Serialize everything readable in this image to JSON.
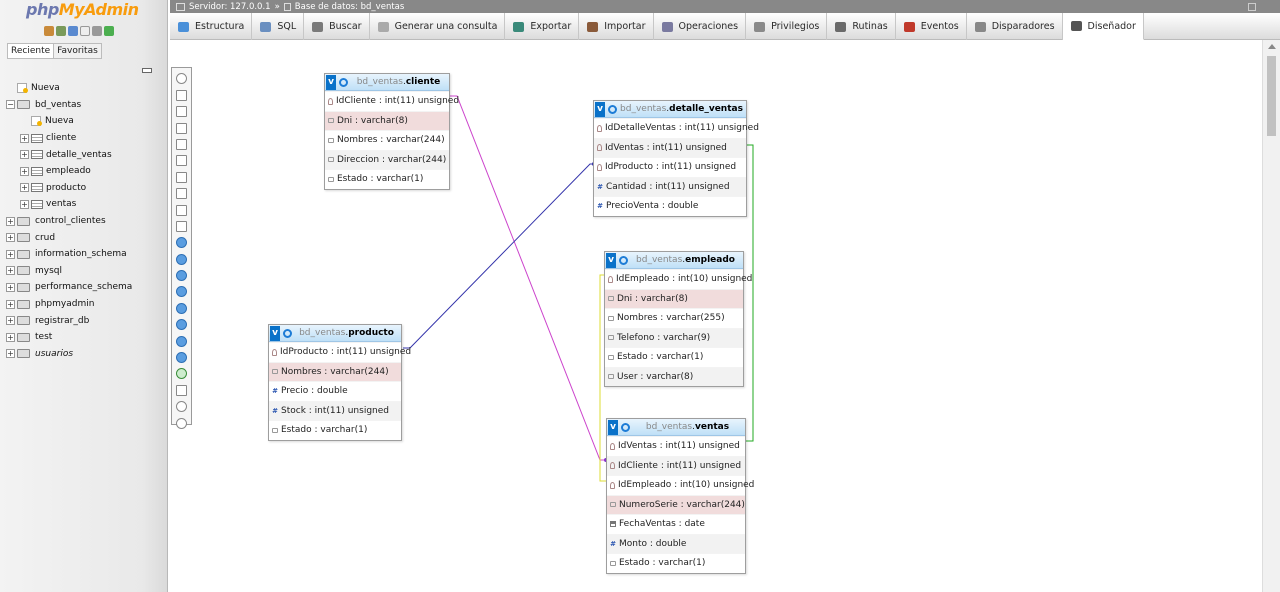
{
  "logo": {
    "part1": "php",
    "part2": "MyAdmin"
  },
  "nav_tabs": [
    "Reciente",
    "Favoritas"
  ],
  "tree": [
    {
      "label": "Nueva",
      "level": 0,
      "kind": "new",
      "expander": ""
    },
    {
      "label": "bd_ventas",
      "level": 0,
      "kind": "db",
      "expander": "−"
    },
    {
      "label": "Nueva",
      "level": 1,
      "kind": "new",
      "expander": ""
    },
    {
      "label": "cliente",
      "level": 1,
      "kind": "table",
      "expander": "+"
    },
    {
      "label": "detalle_ventas",
      "level": 1,
      "kind": "table",
      "expander": "+"
    },
    {
      "label": "empleado",
      "level": 1,
      "kind": "table",
      "expander": "+"
    },
    {
      "label": "producto",
      "level": 1,
      "kind": "table",
      "expander": "+"
    },
    {
      "label": "ventas",
      "level": 1,
      "kind": "table",
      "expander": "+"
    },
    {
      "label": "control_clientes",
      "level": 0,
      "kind": "db",
      "expander": "+"
    },
    {
      "label": "crud",
      "level": 0,
      "kind": "db",
      "expander": "+"
    },
    {
      "label": "information_schema",
      "level": 0,
      "kind": "db",
      "expander": "+"
    },
    {
      "label": "mysql",
      "level": 0,
      "kind": "db",
      "expander": "+"
    },
    {
      "label": "performance_schema",
      "level": 0,
      "kind": "db",
      "expander": "+"
    },
    {
      "label": "phpmyadmin",
      "level": 0,
      "kind": "db",
      "expander": "+"
    },
    {
      "label": "registrar_db",
      "level": 0,
      "kind": "db",
      "expander": "+"
    },
    {
      "label": "test",
      "level": 0,
      "kind": "db",
      "expander": "+"
    },
    {
      "label": "usuarios",
      "level": 0,
      "kind": "db",
      "expander": "+",
      "italic": true
    }
  ],
  "breadcrumb": {
    "server": "Servidor: 127.0.0.1",
    "sep": "»",
    "database": "Base de datos: bd_ventas"
  },
  "tabs": [
    {
      "label": "Estructura",
      "color": "#4a90d9"
    },
    {
      "label": "SQL",
      "color": "#6a8fc0"
    },
    {
      "label": "Buscar",
      "color": "#7a7a7a"
    },
    {
      "label": "Generar una consulta",
      "color": "#aaaaaa"
    },
    {
      "label": "Exportar",
      "color": "#3a8a7a"
    },
    {
      "label": "Importar",
      "color": "#8a5a3a"
    },
    {
      "label": "Operaciones",
      "color": "#7a7aa0"
    },
    {
      "label": "Privilegios",
      "color": "#8a8a8a"
    },
    {
      "label": "Rutinas",
      "color": "#6a6a6a"
    },
    {
      "label": "Eventos",
      "color": "#c0392b"
    },
    {
      "label": "Disparadores",
      "color": "#888888"
    },
    {
      "label": "Diseñador",
      "color": "#555555",
      "active": true
    }
  ],
  "designer_tables": [
    {
      "db": "bd_ventas",
      "name": "cliente",
      "columns": [
        {
          "text": "IdCliente : int(11) unsigned",
          "type": "key"
        },
        {
          "text": "Dni : varchar(8)",
          "type": "txt",
          "hl": true
        },
        {
          "text": "Nombres : varchar(244)",
          "type": "txt"
        },
        {
          "text": "Direccion : varchar(244)",
          "type": "txt"
        },
        {
          "text": "Estado : varchar(1)",
          "type": "txt"
        }
      ]
    },
    {
      "db": "bd_ventas",
      "name": "detalle_ventas",
      "columns": [
        {
          "text": "IdDetalleVentas : int(11) unsigned",
          "type": "key"
        },
        {
          "text": "IdVentas : int(11) unsigned",
          "type": "key"
        },
        {
          "text": "IdProducto : int(11) unsigned",
          "type": "key"
        },
        {
          "text": "Cantidad : int(11) unsigned",
          "type": "num"
        },
        {
          "text": "PrecioVenta : double",
          "type": "num"
        }
      ]
    },
    {
      "db": "bd_ventas",
      "name": "empleado",
      "columns": [
        {
          "text": "IdEmpleado : int(10) unsigned",
          "type": "key"
        },
        {
          "text": "Dni : varchar(8)",
          "type": "txt",
          "hl": true
        },
        {
          "text": "Nombres : varchar(255)",
          "type": "txt"
        },
        {
          "text": "Telefono : varchar(9)",
          "type": "txt"
        },
        {
          "text": "Estado : varchar(1)",
          "type": "txt"
        },
        {
          "text": "User : varchar(8)",
          "type": "txt"
        }
      ]
    },
    {
      "db": "bd_ventas",
      "name": "producto",
      "columns": [
        {
          "text": "IdProducto : int(11) unsigned",
          "type": "key"
        },
        {
          "text": "Nombres : varchar(244)",
          "type": "txt",
          "hl": true
        },
        {
          "text": "Precio : double",
          "type": "num"
        },
        {
          "text": "Stock : int(11) unsigned",
          "type": "num"
        },
        {
          "text": "Estado : varchar(1)",
          "type": "txt"
        }
      ]
    },
    {
      "db": "bd_ventas",
      "name": "ventas",
      "columns": [
        {
          "text": "IdVentas : int(11) unsigned",
          "type": "key"
        },
        {
          "text": "IdCliente : int(11) unsigned",
          "type": "key"
        },
        {
          "text": "IdEmpleado : int(10) unsigned",
          "type": "key"
        },
        {
          "text": "NumeroSerie : varchar(244)",
          "type": "txt",
          "hl": true
        },
        {
          "text": "FechaVentas : date",
          "type": "date"
        },
        {
          "text": "Monto : double",
          "type": "num"
        },
        {
          "text": "Estado : varchar(1)",
          "type": "txt"
        }
      ]
    }
  ],
  "relation_colors": {
    "cliente_ventas": "#cc44cc",
    "producto_detalle": "#3333aa",
    "ventas_detalle": "#22aa22",
    "empleado_ventas": "#dddd33"
  },
  "side_menu_icons": [
    "circle",
    "sq",
    "sq",
    "sq",
    "sq",
    "sq",
    "sq",
    "sq",
    "sq",
    "note",
    "blue",
    "blue",
    "blue",
    "blue",
    "blue",
    "blue",
    "blue",
    "blue",
    "green",
    "sq",
    "circle",
    "anchor"
  ]
}
